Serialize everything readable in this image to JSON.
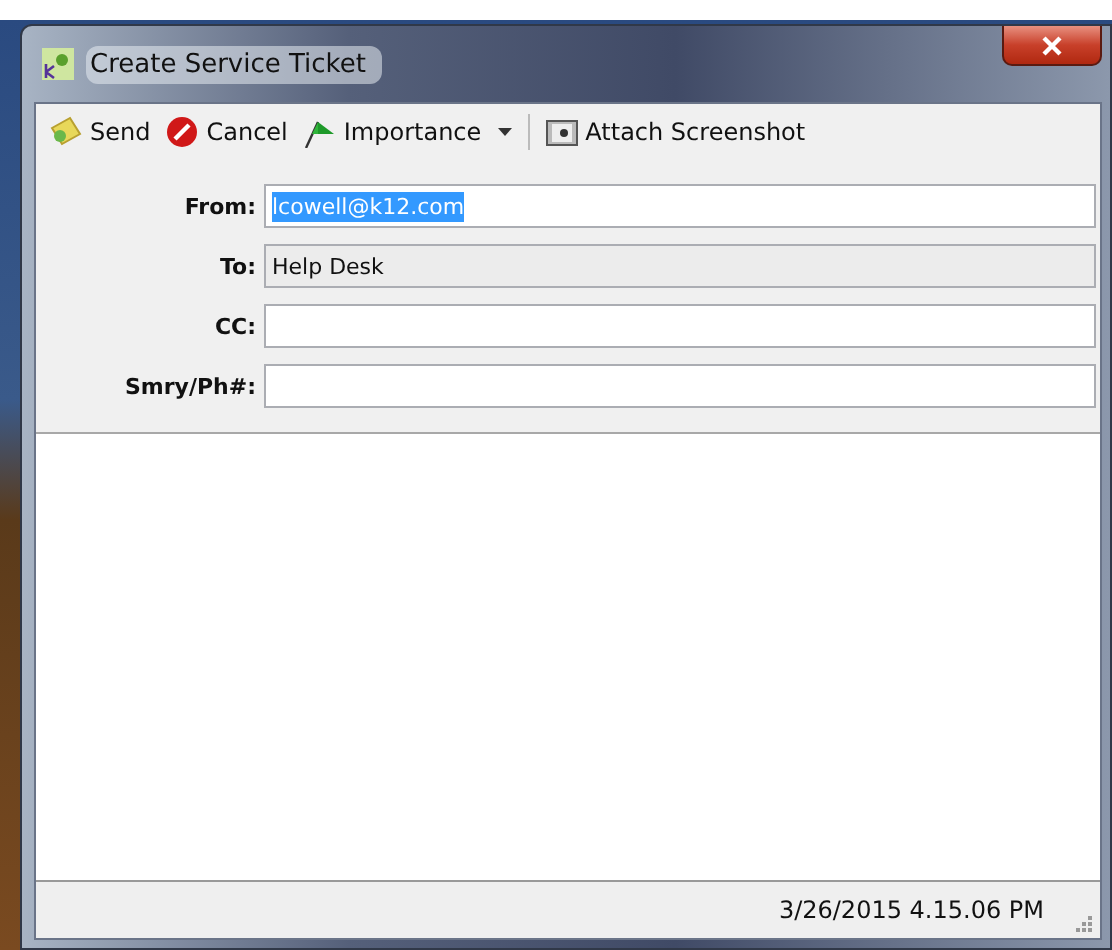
{
  "window": {
    "title": "Create Service Ticket"
  },
  "toolbar": [
    {
      "kind": "send",
      "label": "Send"
    },
    {
      "kind": "cancel",
      "label": "Cancel"
    },
    {
      "kind": "importance",
      "label": "Importance",
      "dropdown": true
    },
    {
      "kind": "separator"
    },
    {
      "kind": "screenshot",
      "label": "Attach Screenshot"
    }
  ],
  "fields": [
    {
      "label": "From:",
      "value": "lcowell@k12.com",
      "readonly": false,
      "text_selected": true
    },
    {
      "label": "To:",
      "value": "Help Desk",
      "readonly": true,
      "text_selected": false
    },
    {
      "label": "CC:",
      "readonly": false
    },
    {
      "label": "Smry/Ph#:",
      "readonly": false
    }
  ],
  "status_bar": {
    "timestamp": "3/26/2015 4.15.06 PM"
  }
}
